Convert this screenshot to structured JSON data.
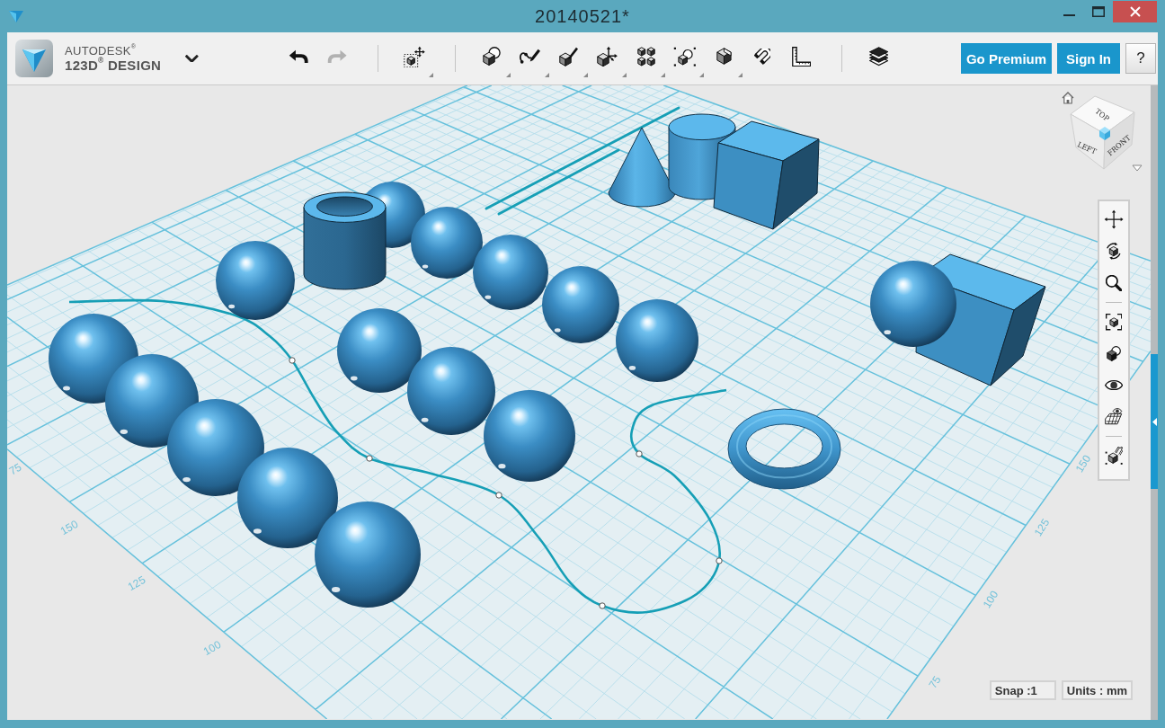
{
  "window": {
    "title": "20140521*",
    "controls": [
      {
        "kind": "minimize"
      },
      {
        "kind": "maximize"
      },
      {
        "kind": "close"
      }
    ]
  },
  "toolbar": {
    "app_menu": {
      "brand": "AUTODESK$^{®}$",
      "product": "123D$^{®}$ DESIGN"
    },
    "groups": [
      [
        {
          "kind": "undo",
          "menu": false,
          "disabled": false
        },
        {
          "kind": "redo",
          "menu": false,
          "disabled": true
        }
      ],
      [
        {
          "kind": "transform",
          "menu": true,
          "disabled": false
        }
      ],
      [
        {
          "kind": "primitives",
          "menu": true,
          "disabled": false
        },
        {
          "kind": "sketch",
          "menu": true,
          "disabled": false
        },
        {
          "kind": "construct",
          "menu": true,
          "disabled": false
        },
        {
          "kind": "modify",
          "menu": true,
          "disabled": false
        },
        {
          "kind": "pattern",
          "menu": true,
          "disabled": false
        },
        {
          "kind": "grouping",
          "menu": true,
          "disabled": false
        },
        {
          "kind": "combine",
          "menu": true,
          "disabled": false
        },
        {
          "kind": "snap",
          "menu": false,
          "disabled": false
        },
        {
          "kind": "measure",
          "menu": false,
          "disabled": false
        }
      ],
      [
        {
          "kind": "material",
          "menu": false,
          "disabled": false
        }
      ]
    ],
    "account_buttons": [
      {
        "label": "Go Premium",
        "kind": "upgrade"
      },
      {
        "label": "Sign In",
        "kind": "sign_in"
      },
      {
        "label": "?",
        "kind": "help"
      }
    ]
  },
  "viewport": {
    "scene": [
      {
        "kind": "line"
      },
      {
        "kind": "line"
      },
      {
        "kind": "spline"
      },
      {
        "kind": "cone"
      },
      {
        "kind": "cylinder"
      },
      {
        "kind": "cube"
      },
      {
        "kind": "sphere"
      },
      {
        "kind": "tube"
      },
      {
        "kind": "sphere"
      },
      {
        "kind": "sphere"
      },
      {
        "kind": "sphere"
      },
      {
        "kind": "sphere"
      },
      {
        "kind": "sphere"
      },
      {
        "kind": "cube"
      },
      {
        "kind": "sphere"
      },
      {
        "kind": "sphere"
      },
      {
        "kind": "sphere"
      },
      {
        "kind": "sphere"
      },
      {
        "kind": "torus"
      },
      {
        "kind": "sphere"
      },
      {
        "kind": "sphere"
      },
      {
        "kind": "sphere"
      },
      {
        "kind": "sphere"
      },
      {
        "kind": "sphere"
      }
    ],
    "grid": {
      "left_scale": [
        "75",
        "150",
        "125",
        "100"
      ],
      "right_scale": [
        "150",
        "125",
        "100",
        "75"
      ]
    },
    "view_cube": {
      "faces": [
        "TOP",
        "LEFT",
        "FRONT"
      ]
    },
    "navigation_bar": [
      [
        {
          "kind": "pan"
        },
        {
          "kind": "orbit"
        },
        {
          "kind": "zoom"
        }
      ],
      [
        {
          "kind": "fit"
        },
        {
          "kind": "projection"
        },
        {
          "kind": "visibility"
        },
        {
          "kind": "display"
        }
      ],
      [
        {
          "kind": "snap"
        }
      ]
    ],
    "status": [
      {
        "label": "Snap :1"
      },
      {
        "label": "Units : mm"
      }
    ]
  }
}
